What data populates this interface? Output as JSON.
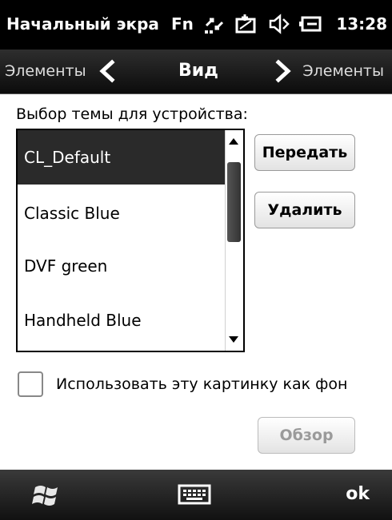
{
  "statusbar": {
    "title": "Начальный экра",
    "fn_label": "Fn",
    "time": "13:28",
    "icons": [
      "data-connection-icon",
      "signal-off-icon",
      "speaker-mute-icon",
      "battery-charging-icon"
    ]
  },
  "navbar": {
    "prev_label": "Элементы",
    "current_label": "Вид",
    "next_label": "Элементы"
  },
  "content": {
    "section_label": "Выбор темы для устройства:",
    "themes": [
      {
        "label": "CL_Default",
        "selected": true
      },
      {
        "label": "Classic Blue",
        "selected": false
      },
      {
        "label": "DVF green",
        "selected": false
      },
      {
        "label": "Handheld Blue",
        "selected": false
      }
    ],
    "transfer_button": "Передать",
    "delete_button": "Удалить",
    "checkbox_label": "Использовать эту картинку как фон",
    "checkbox_checked": false,
    "browse_button": "Обзор"
  },
  "softbar": {
    "right_label": "ok"
  },
  "colors": {
    "selected_bg": "#2a2a2a",
    "bar_bg": "#000000",
    "disabled_text": "#9a9a9a"
  }
}
